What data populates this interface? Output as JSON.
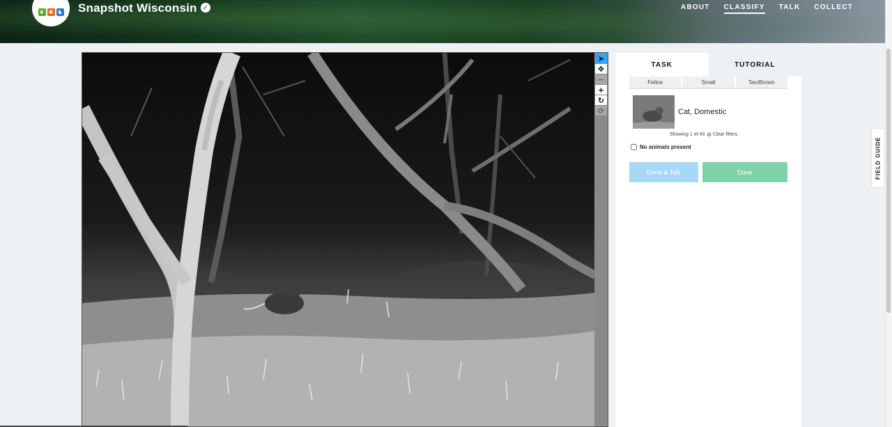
{
  "header": {
    "project_title": "Snapshot Wisconsin",
    "nav": [
      {
        "label": "ABOUT",
        "active": false
      },
      {
        "label": "CLASSIFY",
        "active": true
      },
      {
        "label": "TALK",
        "active": false
      },
      {
        "label": "COLLECT",
        "active": false
      }
    ],
    "logo_icons": [
      "leaf-icon",
      "sun-icon",
      "deer-icon"
    ],
    "verified_icon": "check-badge-icon"
  },
  "viewer": {
    "tools": [
      {
        "name": "pointer-tool",
        "icon": "pointer-icon",
        "glyph": "➤",
        "state": "active"
      },
      {
        "name": "pan-tool",
        "icon": "move-icon",
        "glyph": "✥",
        "state": "normal"
      },
      {
        "name": "zoom-out-tool",
        "icon": "minus-icon",
        "glyph": "−",
        "state": "disabled"
      },
      {
        "name": "zoom-in-tool",
        "icon": "plus-icon",
        "glyph": "+",
        "state": "normal"
      },
      {
        "name": "rotate-tool",
        "icon": "rotate-icon",
        "glyph": "↻",
        "state": "normal"
      },
      {
        "name": "reset-tool",
        "icon": "reset-icon",
        "glyph": "⟳",
        "state": "disabled"
      }
    ]
  },
  "panel": {
    "tabs": {
      "task": "TASK",
      "tutorial": "TUTORIAL"
    },
    "filters": [
      "Feline",
      "Small",
      "Tan/Brown"
    ],
    "result": {
      "label": "Cat, Domestic"
    },
    "showing_text": "Showing 1 of 43",
    "clear_filters": "Clear filters",
    "no_animals": "No animals present",
    "done_talk": "Done & Talk",
    "done": "Done"
  },
  "field_guide": "FIELD GUIDE",
  "colors": {
    "done_talk_bg": "#a8d8f8",
    "done_bg": "#7fd3a8",
    "active_tool": "#2aa5ff",
    "page_bg": "#eef1f4"
  }
}
